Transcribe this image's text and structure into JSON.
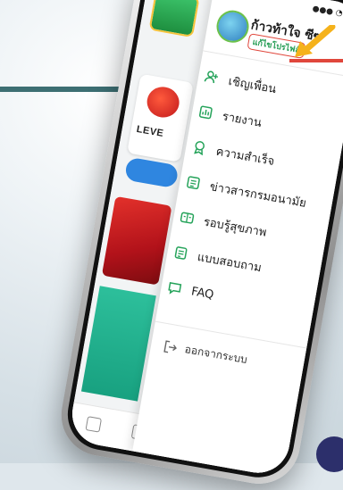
{
  "profile": {
    "name": "ก้าวท้าใจ ซีซ",
    "edit_label": "แก้ไขโปรไฟล์"
  },
  "menu": [
    {
      "label": "เชิญเพื่อน",
      "icon": "invite-friend-icon"
    },
    {
      "label": "รายงาน",
      "icon": "report-icon"
    },
    {
      "label": "ความสำเร็จ",
      "icon": "achievement-icon"
    },
    {
      "label": "ข่าวสารกรมอนามัย",
      "icon": "news-icon"
    },
    {
      "label": "รอบรู้สุขภาพ",
      "icon": "health-literacy-icon"
    },
    {
      "label": "แบบสอบถาม",
      "icon": "survey-icon"
    },
    {
      "label": "FAQ",
      "icon": "faq-icon"
    }
  ],
  "logout": {
    "label": "ออกจากระบบ",
    "icon": "logout-icon"
  },
  "background_app": {
    "level_label": "LEVE"
  },
  "colors": {
    "accent_green": "#1f9a50",
    "highlight_red": "#e0473c",
    "arrow_yellow": "#f5b21b",
    "pointer_teal": "#3d6f73"
  }
}
